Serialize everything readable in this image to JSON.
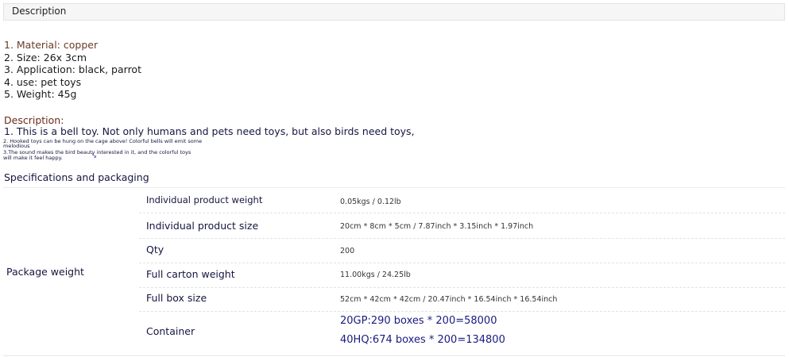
{
  "tab": {
    "label": "Description"
  },
  "attributes": [
    "1. Material: copper",
    "2. Size: 26x 3cm",
    "3. Application: black, parrot",
    "4. use: pet toys",
    "5. Weight: 45g"
  ],
  "description": {
    "heading": "Description:",
    "line1": "1. This is a bell toy. Not only humans and pets need toys, but also birds need toys,",
    "small_lines": [
      "2. Hooked toys can be hung on the cage above! Colorful bells will emit some",
      "melodious",
      "3.The sound makes the bird beauty interested in it, and the colorful toys",
      "will make it feel happy."
    ]
  },
  "specs": {
    "heading": "Specifications and packaging",
    "group_label": "Package weight",
    "rows": [
      {
        "name": "Individual product weight",
        "value": "0.05kgs / 0.12lb"
      },
      {
        "name": "Individual product size",
        "value": "20cm * 8cm * 5cm / 7.87inch * 3.15inch * 1.97inch"
      },
      {
        "name": "Qty",
        "value": "200"
      },
      {
        "name": "Full carton weight",
        "value": "11.00kgs / 24.25lb"
      },
      {
        "name": "Full box size",
        "value": "52cm * 42cm * 42cm / 20.47inch * 16.54inch * 16.54inch"
      }
    ],
    "container": {
      "name": "Container",
      "values": [
        "20GP:290 boxes * 200=58000",
        "40HQ:674 boxes * 200=134800"
      ]
    }
  }
}
